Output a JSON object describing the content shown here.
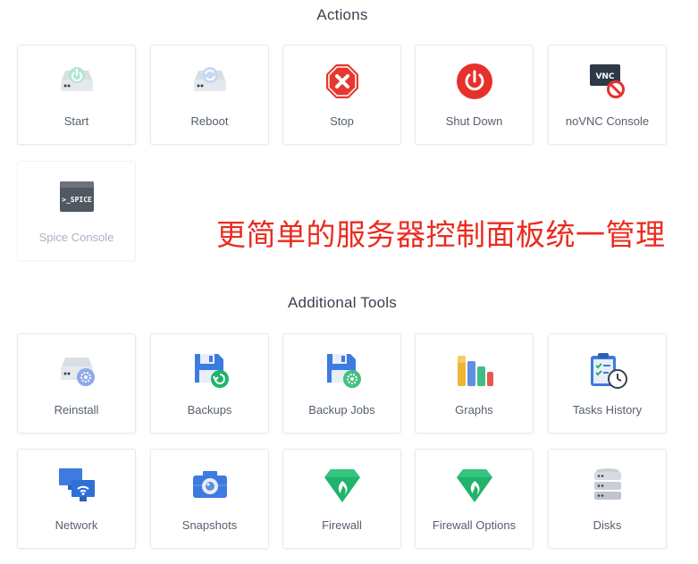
{
  "actions": {
    "title": "Actions",
    "items": [
      {
        "label": "Start",
        "icon": "server-power-icon"
      },
      {
        "label": "Reboot",
        "icon": "server-reboot-icon"
      },
      {
        "label": "Stop",
        "icon": "stop-icon"
      },
      {
        "label": "Shut Down",
        "icon": "power-icon"
      },
      {
        "label": "noVNC Console",
        "icon": "vnc-disabled-icon"
      },
      {
        "label": "Spice Console",
        "icon": "spice-console-icon"
      }
    ]
  },
  "overlay": {
    "text": "更简单的服务器控制面板统一管理"
  },
  "tools": {
    "title": "Additional Tools",
    "items": [
      {
        "label": "Reinstall",
        "icon": "server-gear-icon"
      },
      {
        "label": "Backups",
        "icon": "floppy-restore-icon"
      },
      {
        "label": "Backup Jobs",
        "icon": "floppy-gear-icon"
      },
      {
        "label": "Graphs",
        "icon": "bar-chart-icon"
      },
      {
        "label": "Tasks History",
        "icon": "clipboard-clock-icon"
      },
      {
        "label": "Network",
        "icon": "network-monitors-icon"
      },
      {
        "label": "Snapshots",
        "icon": "camera-icon"
      },
      {
        "label": "Firewall",
        "icon": "firewall-gem-icon"
      },
      {
        "label": "Firewall Options",
        "icon": "firewall-options-icon"
      },
      {
        "label": "Disks",
        "icon": "disks-icon"
      }
    ]
  },
  "colors": {
    "accent": "#ea2b1f",
    "blue": "#3d7be0",
    "green": "#1fb36b"
  }
}
